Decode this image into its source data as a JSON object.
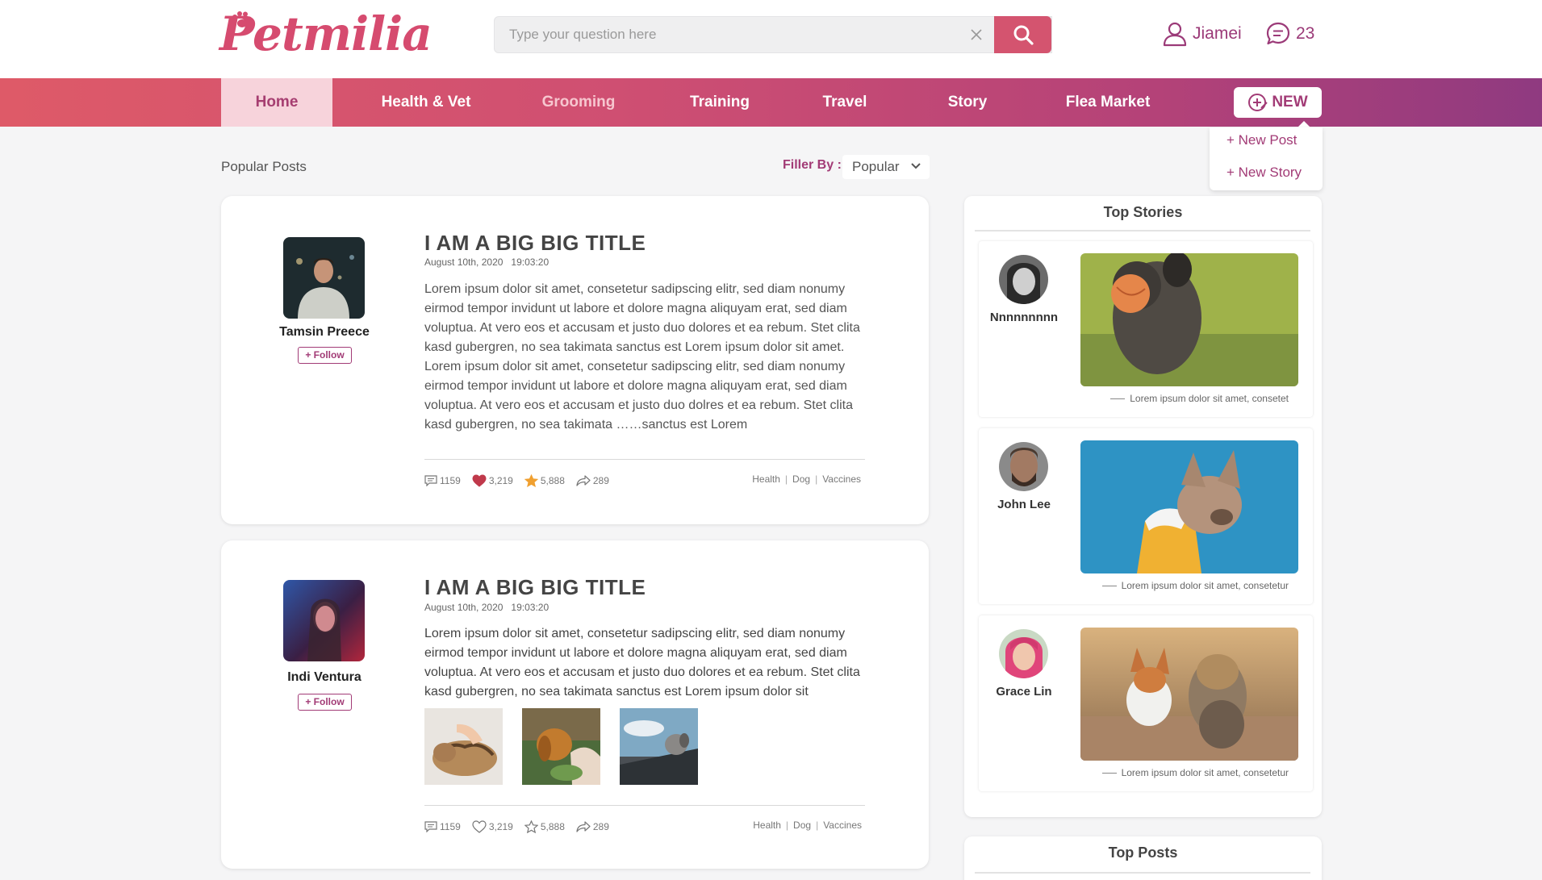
{
  "brand": {
    "logo_text": "Petmilia",
    "accent": "#d4546f",
    "secondary": "#a23b76"
  },
  "search": {
    "placeholder": "Type your question here",
    "value": ""
  },
  "header": {
    "user_name": "Jiamei",
    "message_count": "23"
  },
  "nav": {
    "items": [
      {
        "label": "Home"
      },
      {
        "label": "Health & Vet"
      },
      {
        "label": "Grooming"
      },
      {
        "label": "Training"
      },
      {
        "label": "Travel"
      },
      {
        "label": "Story"
      },
      {
        "label": "Flea Market"
      }
    ],
    "new_label": "NEW",
    "new_menu": [
      "+ New Post",
      "+ New Story"
    ]
  },
  "main": {
    "section_title": "Popular Posts",
    "filter_label": "Filler By :",
    "filter_value": "Popular"
  },
  "posts": [
    {
      "author": "Tamsin Preece",
      "follow_label": "+ Follow",
      "title": "I AM A BIG BIG TITLE",
      "date": "August 10th, 2020",
      "time": "19:03:20",
      "body": "Lorem ipsum dolor sit amet, consetetur sadipscing elitr, sed diam nonumy eirmod tempor invidunt ut labore et dolore magna aliquyam erat, sed diam voluptua. At vero eos et accusam et justo duo dolores et ea rebum. Stet clita kasd gubergren, no sea takimata sanctus est Lorem ipsum dolor sit amet. Lorem ipsum dolor sit amet, consetetur sadipscing elitr, sed diam nonumy eirmod tempor invidunt ut labore et dolore magna aliquyam erat, sed diam voluptua. At vero eos et accusam et justo duo dolres et ea rebum. Stet clita kasd gubergren, no sea takimata ……sanctus est Lorem",
      "comments": "1159",
      "likes": "3,219",
      "stars": "5,888",
      "shares": "289",
      "liked": true,
      "starred": true,
      "tags": [
        "Health",
        "Dog",
        "Vaccines"
      ]
    },
    {
      "author": "Indi Ventura",
      "follow_label": "+ Follow",
      "title": "I AM A BIG BIG TITLE",
      "date": "August 10th, 2020",
      "time": "19:03:20",
      "body": "Lorem ipsum dolor sit amet, consetetur sadipscing elitr, sed diam nonumy eirmod tempor invidunt ut labore et dolore magna aliquyam erat, sed diam voluptua. At vero eos et accusam et justo duo dolores et ea rebum. Stet clita kasd gubergren, no sea takimata sanctus est Lorem ipsum dolor sit",
      "comments": "1159",
      "likes": "3,219",
      "stars": "5,888",
      "shares": "289",
      "liked": false,
      "starred": false,
      "tags": [
        "Health",
        "Dog",
        "Vaccines"
      ]
    }
  ],
  "sidebar": {
    "top_stories_title": "Top Stories",
    "stories": [
      {
        "name": "Nnnnnnnnn",
        "caption": "Lorem ipsum dolor sit amet, consetet"
      },
      {
        "name": "John Lee",
        "caption": "Lorem ipsum dolor sit amet, consetetur"
      },
      {
        "name": "Grace Lin",
        "caption": "Lorem ipsum dolor sit amet, consetetur"
      }
    ],
    "top_posts_title": "Top Posts"
  }
}
